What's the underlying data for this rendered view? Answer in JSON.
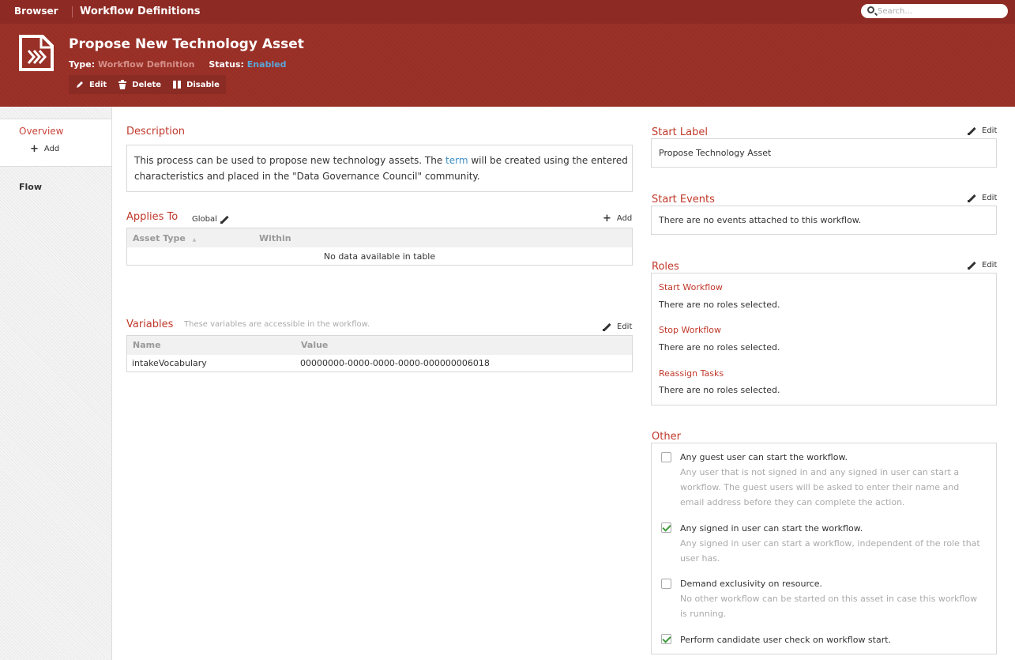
{
  "topbar": {
    "browser": "Browser",
    "section": "Workflow Definitions",
    "search_placeholder": "Search..."
  },
  "header": {
    "title": "Propose New Technology Asset",
    "type_label": "Type:",
    "type_value": "Workflow Definition",
    "status_label": "Status:",
    "status_value": "Enabled",
    "actions": {
      "edit": "Edit",
      "delete": "Delete",
      "disable": "Disable"
    }
  },
  "sidebar": {
    "overview": "Overview",
    "add": "Add",
    "flow": "Flow"
  },
  "description": {
    "title": "Description",
    "text_before": "This process can be used to propose new technology assets. The ",
    "link": "term",
    "text_after": " will be created using the entered characteristics and placed in the \"Data Governance Council\" community."
  },
  "applies_to": {
    "title": "Applies To",
    "scope": "Global",
    "add": "Add",
    "columns": [
      "Asset Type",
      "Within"
    ],
    "sort_glyph": "▲",
    "empty": "No data available in table"
  },
  "variables": {
    "title": "Variables",
    "hint": "These variables are accessible in the workflow.",
    "edit": "Edit",
    "columns": [
      "Name",
      "Value"
    ],
    "rows": [
      {
        "name": "intakeVocabulary",
        "value": "00000000-0000-0000-0000-000000006018"
      }
    ]
  },
  "start_label": {
    "title": "Start Label",
    "edit": "Edit",
    "value": "Propose Technology Asset"
  },
  "start_events": {
    "title": "Start Events",
    "edit": "Edit",
    "value": "There are no events attached to this workflow."
  },
  "roles": {
    "title": "Roles",
    "edit": "Edit",
    "items": [
      {
        "label": "Start Workflow",
        "value": "There are no roles selected."
      },
      {
        "label": "Stop Workflow",
        "value": "There are no roles selected."
      },
      {
        "label": "Reassign Tasks",
        "value": "There are no roles selected."
      }
    ]
  },
  "other": {
    "title": "Other",
    "options": [
      {
        "label": "Any guest user can start the workflow.",
        "checked": false,
        "help": "Any user that is not signed in and any signed in user can start a workflow. The guest users will be asked to enter their name and email address before they can complete the action."
      },
      {
        "label": "Any signed in user can start the workflow.",
        "checked": true,
        "help": "Any signed in user can start a workflow, independent of the role that user has."
      },
      {
        "label": "Demand exclusivity on resource.",
        "checked": false,
        "help": "No other workflow can be started on this asset in case this workflow is running."
      },
      {
        "label": "Perform candidate user check on workflow start.",
        "checked": true,
        "help": ""
      }
    ]
  },
  "colors": {
    "brand": "#8e2a24",
    "header": "#9c3128",
    "accent": "#c0392b",
    "link": "#3d8ec9",
    "check": "#3e9a3a"
  }
}
